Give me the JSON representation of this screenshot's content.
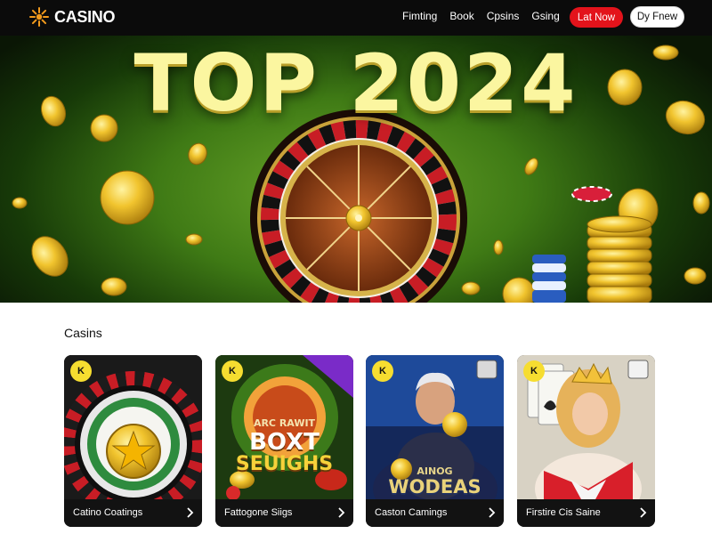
{
  "header": {
    "brand": "CASINO",
    "brand_logo_icon": "sunburst-logo-icon",
    "nav_links": [
      "Fimting",
      "Book",
      "Cpsins",
      "Gsing"
    ],
    "cta_primary": "Lat Now",
    "cta_secondary": "Dy Fnew"
  },
  "hero": {
    "title": "TOP 2024"
  },
  "section": {
    "title": "Casins"
  },
  "cards": [
    {
      "label": "Catino Coatings",
      "badge": "K",
      "art_icon": "roulette-star-icon"
    },
    {
      "label": "Fattogone Siigs",
      "badge": "K",
      "art_icon": "slot-game-art",
      "art_line1": "ARC RAWIT",
      "art_line2": "BOXT",
      "art_line3": "SEUIGHS"
    },
    {
      "label": "Caston Camings",
      "badge": "K",
      "art_icon": "character-art",
      "art_line1": "AINOG",
      "art_line2": "WODEAS"
    },
    {
      "label": "Firstire Cis Saine",
      "badge": "K",
      "art_icon": "queen-card-art"
    }
  ],
  "colors": {
    "nav_bg": "#0b0b0b",
    "cta_red": "#e3131b",
    "hero_green": "#3f7a15",
    "gold": "#f1c42e",
    "badge_yellow": "#f6dd30"
  }
}
